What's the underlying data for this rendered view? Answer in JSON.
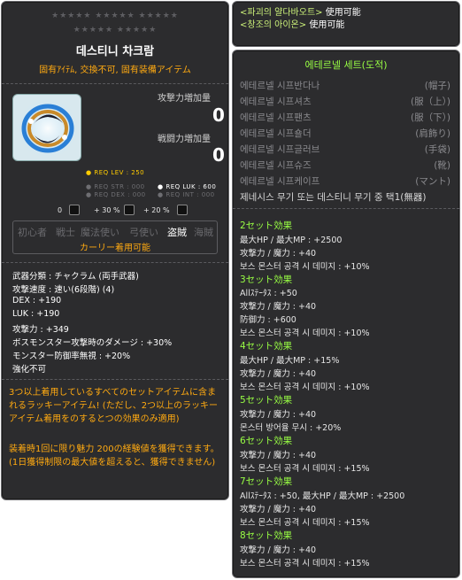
{
  "item": {
    "stars_top": "★★★★★ ★★★★★ ★★★★★",
    "stars_bottom": "★★★★★ ★★★★★",
    "name": "데스티니 차크람",
    "tags": "固有ｱｲﾃﾑ, 交換不可, 固有装備アイテム",
    "stat1_label": "攻撃力増加量",
    "stat1_value": "0",
    "stat2_label": "戦闘力増加量",
    "stat2_value": "0",
    "req_lev": "● REQ LEV : 250",
    "req_str": "● REQ STR : 000",
    "req_luk": "● REQ LUK : 600",
    "req_dex": "● REQ DEX : 000",
    "req_int": "● REQ INT : 000",
    "extra_values": [
      "0",
      "+ 30 %",
      "+ 20 %"
    ],
    "jobs": [
      "初心者",
      "戦士",
      "魔法使い",
      "弓使い",
      "盗賊",
      "海賊"
    ],
    "jobs_note": "カーリー着用可能",
    "details": [
      "武器分類 : チャクラム (両手武器)",
      "攻撃速度 : 速い(6段階) (4)",
      "DEX : +190",
      "LUK : +190",
      "攻撃力 : +349",
      "ボスモンスター攻撃時のダメージ : +30%",
      "モンスター防御率無視 : +20%",
      "強化不可"
    ],
    "desc1": "3つ以上着用しているすべてのセットアイテムに含まれるラッキーアイテム! (ただし、2つ以上のラッキーアイテム着用をのするとつの効果のみ適用)",
    "desc2": "装着時1回に限り魅力 200の経験値を獲得できます。(1日獲得制限の最大値を超えると、獲得できません)"
  },
  "requirements": [
    {
      "name": "<파괴의 얄다바오트>",
      "rest": " 使用可能"
    },
    {
      "name": "<창조의 아이온>",
      "rest": " 使用可能"
    }
  ],
  "set": {
    "title": "에테르넬 세트(도적)",
    "items": [
      {
        "name": "에테르넬 시프반다나",
        "slot": "(帽子)"
      },
      {
        "name": "에테르넬 시프셔츠",
        "slot": "(服（上）)"
      },
      {
        "name": "에테르넬 시프팬츠",
        "slot": "(服（下）)"
      },
      {
        "name": "에테르넬 시프숄더",
        "slot": "(肩飾り)"
      },
      {
        "name": "에테르넬 시프글러브",
        "slot": "(手袋)"
      },
      {
        "name": "에테르넬 시프슈즈",
        "slot": "(靴)"
      },
      {
        "name": "에테르넬 시프케이프",
        "slot": "(マント)"
      }
    ],
    "genesis": "제네시스 무기 또는 데스티니 무기 중 택1(無器)",
    "effects": [
      {
        "head": "2セット効果",
        "lines": [
          "最大HP / 最大MP : +2500",
          "攻撃力 / 魔力 : +40",
          "보스 몬스터 공격 시 데미지 : +10%"
        ]
      },
      {
        "head": "3セット効果",
        "lines": [
          "Allｽﾃｰﾀｽ : +50",
          "攻撃力 / 魔力 : +40",
          "防御力 : +600",
          "보스 몬스터 공격 시 데미지 : +10%"
        ]
      },
      {
        "head": "4セット効果",
        "lines": [
          "最大HP / 最大MP : +15%",
          "攻撃力 / 魔力 : +40",
          "보스 몬스터 공격 시 데미지 : +10%"
        ]
      },
      {
        "head": "5セット効果",
        "lines": [
          "攻撃力 / 魔力 : +40",
          "몬스터 방어율 무시 : +20%"
        ]
      },
      {
        "head": "6セット効果",
        "lines": [
          "攻撃力 / 魔力 : +40",
          "보스 몬스터 공격 시 데미지 : +15%"
        ]
      },
      {
        "head": "7セット効果",
        "lines": [
          "Allｽﾃｰﾀｽ : +50, 最大HP / 最大MP : +2500",
          "攻撃力 / 魔力 : +40",
          "보스 몬스터 공격 시 데미지 : +15%"
        ]
      },
      {
        "head": "8セット効果",
        "lines": [
          "攻撃力 / 魔力 : +40",
          "보스 몬스터 공격 시 데미지 : +15%"
        ]
      }
    ]
  }
}
